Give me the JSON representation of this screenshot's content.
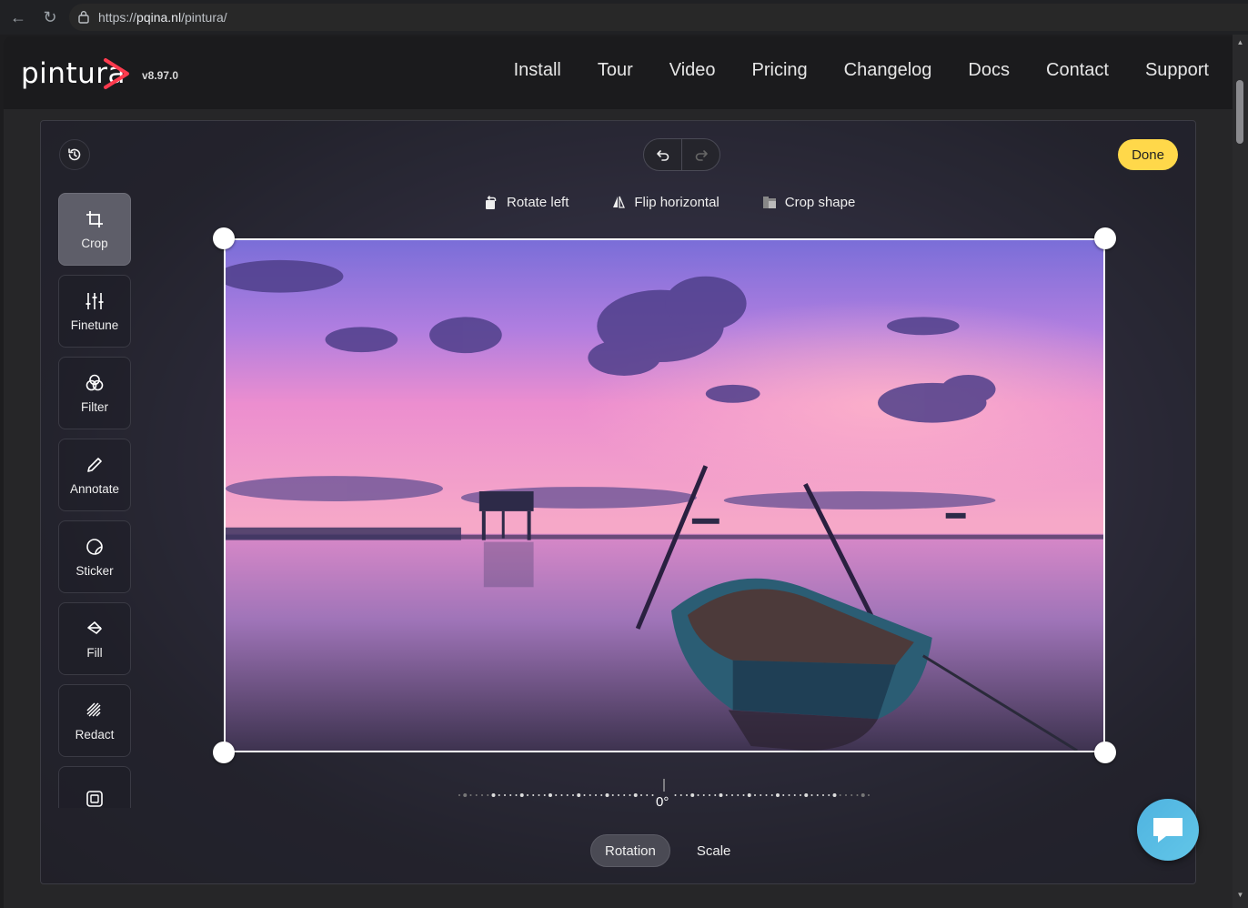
{
  "browser": {
    "url_prefix": "https://",
    "url_domain": "pqina.nl",
    "url_path": "/pintura/"
  },
  "site": {
    "logo_text": "pintura",
    "version": "v8.97.0",
    "nav": [
      "Install",
      "Tour",
      "Video",
      "Pricing",
      "Changelog",
      "Docs",
      "Contact",
      "Support"
    ]
  },
  "editor": {
    "done_label": "Done",
    "toolbar": [
      {
        "label": "Rotate left",
        "icon": "rotate-left-icon"
      },
      {
        "label": "Flip horizontal",
        "icon": "flip-horizontal-icon"
      },
      {
        "label": "Crop shape",
        "icon": "crop-shape-icon"
      }
    ],
    "side_tabs": [
      {
        "label": "Crop",
        "icon": "crop-icon",
        "active": true
      },
      {
        "label": "Finetune",
        "icon": "finetune-icon",
        "active": false
      },
      {
        "label": "Filter",
        "icon": "filter-icon",
        "active": false
      },
      {
        "label": "Annotate",
        "icon": "annotate-icon",
        "active": false
      },
      {
        "label": "Sticker",
        "icon": "sticker-icon",
        "active": false
      },
      {
        "label": "Fill",
        "icon": "fill-icon",
        "active": false
      },
      {
        "label": "Redact",
        "icon": "redact-icon",
        "active": false
      },
      {
        "label": "",
        "icon": "frame-icon",
        "active": false
      }
    ],
    "rotation_value": "0°",
    "mode_tabs": [
      {
        "label": "Rotation",
        "active": true
      },
      {
        "label": "Scale",
        "active": false
      }
    ],
    "accent_color": "#ffd84a"
  }
}
